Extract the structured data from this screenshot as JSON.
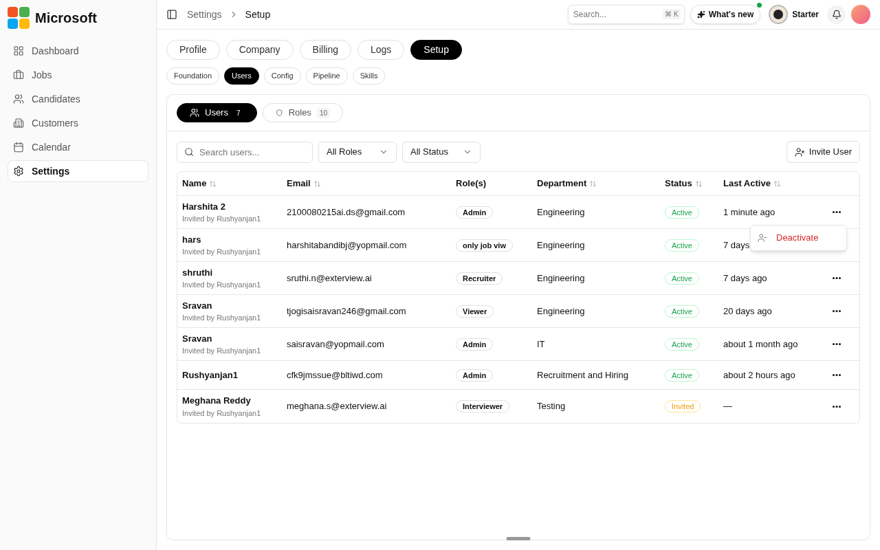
{
  "brand": {
    "name": "Microsoft"
  },
  "sidebar": {
    "items": [
      {
        "label": "Dashboard",
        "selected": false
      },
      {
        "label": "Jobs",
        "selected": false
      },
      {
        "label": "Candidates",
        "selected": false
      },
      {
        "label": "Customers",
        "selected": false
      },
      {
        "label": "Calendar",
        "selected": false
      },
      {
        "label": "Settings",
        "selected": true
      }
    ]
  },
  "header": {
    "breadcrumb": [
      "Settings",
      "Setup"
    ],
    "search": {
      "placeholder": "Search...",
      "shortcut": "⌘ K"
    },
    "whats_new": "What's new",
    "whats_new_dot": true,
    "plan": "Starter"
  },
  "tabs": [
    {
      "label": "Profile",
      "selected": false
    },
    {
      "label": "Company",
      "selected": false
    },
    {
      "label": "Billing",
      "selected": false
    },
    {
      "label": "Logs",
      "selected": false
    },
    {
      "label": "Setup",
      "selected": true
    }
  ],
  "subtabs": [
    {
      "label": "Foundation",
      "selected": false
    },
    {
      "label": "Users",
      "selected": true
    },
    {
      "label": "Config",
      "selected": false
    },
    {
      "label": "Pipeline",
      "selected": false
    },
    {
      "label": "Skills",
      "selected": false
    }
  ],
  "panel_tabs": [
    {
      "label": "Users",
      "count": "7",
      "selected": true
    },
    {
      "label": "Roles",
      "count": "10",
      "selected": false
    }
  ],
  "filters": {
    "search": {
      "placeholder": "Search users..."
    },
    "role": "All Roles",
    "status": "All Status",
    "invite": "Invite User"
  },
  "table": {
    "columns": [
      {
        "label": "Name",
        "sortable": true
      },
      {
        "label": "Email",
        "sortable": true
      },
      {
        "label": "Role(s)",
        "sortable": false
      },
      {
        "label": "Department",
        "sortable": true
      },
      {
        "label": "Status",
        "sortable": true
      },
      {
        "label": "Last Active",
        "sortable": true
      }
    ],
    "rows": [
      {
        "name": "Harshita 2",
        "invited_by": "Invited by Rushyanjan1",
        "email": "2100080215ai.ds@gmail.com",
        "role": "Admin",
        "department": "Engineering",
        "status": "Active",
        "kind": "active",
        "last_active": "1 minute ago"
      },
      {
        "name": "hars",
        "invited_by": "Invited by Rushyanjan1",
        "email": "harshitabandibj@yopmail.com",
        "role": "only job viw",
        "department": "Engineering",
        "status": "Active",
        "kind": "active",
        "last_active": "7 days"
      },
      {
        "name": "shruthi",
        "invited_by": "Invited by Rushyanjan1",
        "email": "sruthi.n@exterview.ai",
        "role": "Recruiter",
        "department": "Engineering",
        "status": "Active",
        "kind": "active",
        "last_active": "7 days ago"
      },
      {
        "name": "Sravan",
        "invited_by": "Invited by Rushyanjan1",
        "email": "tjogisaisravan246@gmail.com",
        "role": "Viewer",
        "department": "Engineering",
        "status": "Active",
        "kind": "active",
        "last_active": "20 days ago"
      },
      {
        "name": "Sravan",
        "invited_by": "Invited by Rushyanjan1",
        "email": "saisravan@yopmail.com",
        "role": "Admin",
        "department": "IT",
        "status": "Active",
        "kind": "active",
        "last_active": "about 1 month ago"
      },
      {
        "name": "Rushyanjan1",
        "email": "cfk9jmssue@bltiwd.com",
        "role": "Admin",
        "department": "Recruitment and Hiring",
        "status": "Active",
        "kind": "active",
        "last_active": "about 2 hours ago"
      },
      {
        "name": "Meghana Reddy",
        "invited_by": "Invited by Rushyanjan1",
        "email": "meghana.s@exterview.ai",
        "role": "Interviewer",
        "department": "Testing",
        "status": "Invited",
        "kind": "invited",
        "last_active": "—"
      }
    ]
  },
  "row_menu": {
    "items": [
      "Deactivate"
    ]
  }
}
